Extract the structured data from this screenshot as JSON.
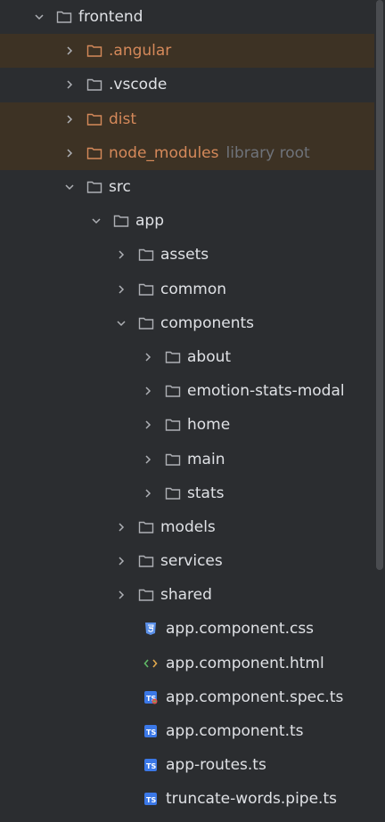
{
  "tree": {
    "root": {
      "label": "frontend"
    },
    "angular": {
      "label": ".angular"
    },
    "vscode": {
      "label": ".vscode"
    },
    "dist": {
      "label": "dist"
    },
    "node_modules": {
      "label": "node_modules",
      "hint": "library root"
    },
    "src": {
      "label": "src"
    },
    "app": {
      "label": "app"
    },
    "assets": {
      "label": "assets"
    },
    "common": {
      "label": "common"
    },
    "components": {
      "label": "components"
    },
    "about": {
      "label": "about"
    },
    "emotion": {
      "label": "emotion-stats-modal"
    },
    "home": {
      "label": "home"
    },
    "main": {
      "label": "main"
    },
    "stats": {
      "label": "stats"
    },
    "models": {
      "label": "models"
    },
    "services": {
      "label": "services"
    },
    "shared": {
      "label": "shared"
    },
    "files": [
      {
        "label": "app.component.css",
        "icon": "css-file-icon"
      },
      {
        "label": "app.component.html",
        "icon": "html-file-icon"
      },
      {
        "label": "app.component.spec.ts",
        "icon": "ts-test-file-icon"
      },
      {
        "label": "app.component.ts",
        "icon": "ts-file-icon"
      },
      {
        "label": "app-routes.ts",
        "icon": "ts-file-icon"
      },
      {
        "label": "truncate-words.pipe.ts",
        "icon": "ts-file-icon"
      }
    ]
  },
  "colors": {
    "background": "#2b2d30",
    "excluded_row": "#3d3224",
    "excluded_text": "#d5895a",
    "text": "#dfe1e5",
    "hint": "#6f737a"
  }
}
